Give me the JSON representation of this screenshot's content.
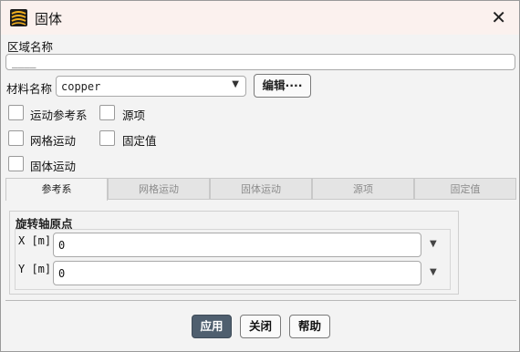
{
  "window": {
    "title": "固体",
    "icon": "fluent-app-icon",
    "close_icon": "close-icon"
  },
  "zone": {
    "label": "区域名称",
    "value": "____"
  },
  "material": {
    "label": "材料名称",
    "selected": "copper",
    "dropdown_icon": "chevron-down-icon",
    "edit_label": "编辑····"
  },
  "options": {
    "motion_frame": "运动参考系",
    "source_terms": "源项",
    "mesh_motion": "网格运动",
    "fixed_values": "固定值",
    "solid_motion": "固体运动"
  },
  "tabs": [
    {
      "label": "参考系",
      "active": true
    },
    {
      "label": "网格运动",
      "active": false
    },
    {
      "label": "固体运动",
      "active": false
    },
    {
      "label": "源项",
      "active": false
    },
    {
      "label": "固定值",
      "active": false
    }
  ],
  "rotation_origin": {
    "title": "旋转轴原点",
    "x_label": "X [m]",
    "x_value": "0",
    "y_label": "Y [m]",
    "y_value": "0"
  },
  "buttons": {
    "apply": "应用",
    "close": "关闭",
    "help": "帮助"
  },
  "colors": {
    "titlebar": "#fbf1ee",
    "primary_button": "#4f5f6f",
    "dialog_background": "#f3f3f3"
  }
}
